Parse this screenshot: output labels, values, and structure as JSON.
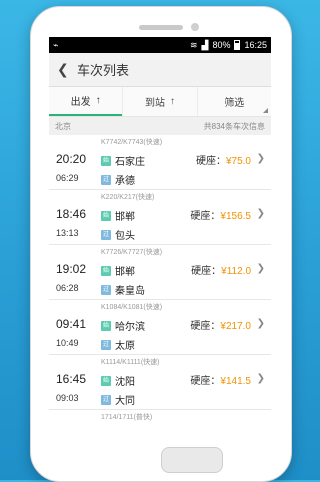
{
  "status": {
    "signal": "80%",
    "time": "16:25"
  },
  "titlebar": {
    "back_icon": "chevron-left-icon",
    "title": "车次列表"
  },
  "tabs": [
    {
      "label": "出发",
      "arrow": "↑"
    },
    {
      "label": "到站",
      "arrow": "↑"
    },
    {
      "label": "筛选"
    }
  ],
  "subheader": {
    "city": "北京",
    "count": "共834条车次信息"
  },
  "badges": {
    "start": "始",
    "pass": "过"
  },
  "rows": [
    {
      "train": "K7742/K7743(快速)",
      "depart": "20:20",
      "arrive": "06:29",
      "from": "石家庄",
      "to": "承德",
      "seat": "硬座：",
      "price": "¥75.0"
    },
    {
      "train": "K220/K217(快速)",
      "depart": "18:46",
      "arrive": "13:13",
      "from": "邯郸",
      "to": "包头",
      "seat": "硬座：",
      "price": "¥156.5"
    },
    {
      "train": "K7726/K7727(快速)",
      "depart": "19:02",
      "arrive": "06:28",
      "from": "邯郸",
      "to": "秦皇岛",
      "seat": "硬座：",
      "price": "¥112.0"
    },
    {
      "train": "K1084/K1081(快速)",
      "depart": "09:41",
      "arrive": "10:49",
      "from": "哈尔滨",
      "to": "太原",
      "seat": "硬座：",
      "price": "¥217.0"
    },
    {
      "train": "K1114/K1111(快速)",
      "depart": "16:45",
      "arrive": "09:03",
      "from": "沈阳",
      "to": "大同",
      "seat": "硬座：",
      "price": "¥141.5"
    }
  ],
  "partial_row": {
    "train": "1714/1711(普快)"
  }
}
